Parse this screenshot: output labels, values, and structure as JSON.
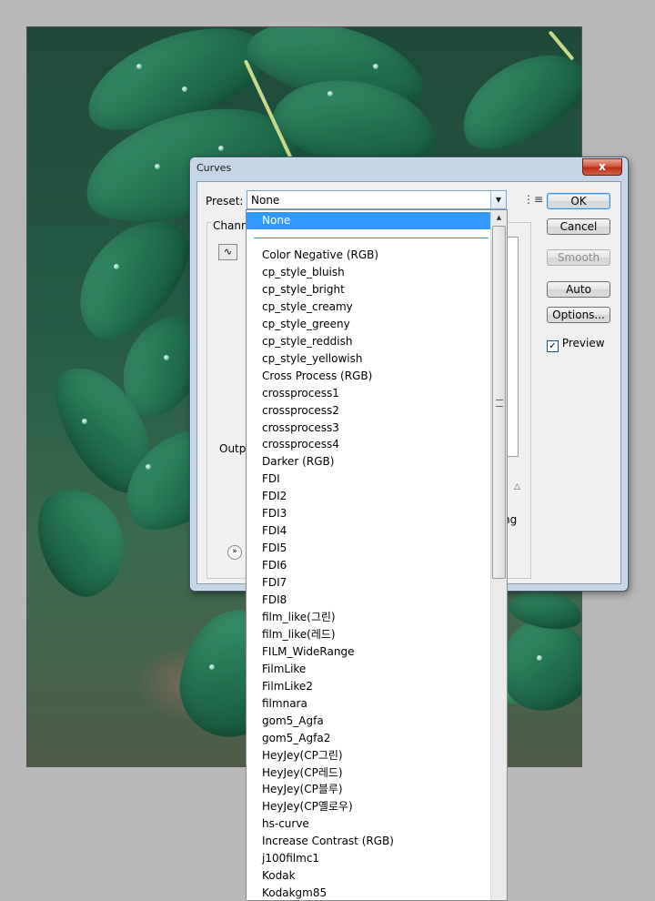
{
  "dialog": {
    "title": "Curves",
    "close_label": "x",
    "preset_label": "Preset:",
    "preset_value": "None",
    "channel_label": "Chann",
    "output_label": "Outp",
    "curve_tool_icon": "curve-icon",
    "fragment_right": "ng",
    "buttons": {
      "ok": "OK",
      "cancel": "Cancel",
      "smooth": "Smooth",
      "auto": "Auto",
      "options": "Options..."
    },
    "preview_label": "Preview",
    "preview_checked": true
  },
  "dropdown": {
    "selected": "None",
    "items": [
      "Color Negative (RGB)",
      "cp_style_bluish",
      "cp_style_bright",
      "cp_style_creamy",
      "cp_style_greeny",
      "cp_style_reddish",
      "cp_style_yellowish",
      "Cross Process (RGB)",
      "crossprocess1",
      "crossprocess2",
      "crossprocess3",
      "crossprocess4",
      "Darker (RGB)",
      "FDI",
      "FDI2",
      "FDI3",
      "FDI4",
      "FDI5",
      "FDI6",
      "FDI7",
      "FDI8",
      "film_like(그린)",
      "film_like(레드)",
      "FILM_WideRange",
      "FilmLike",
      "FilmLike2",
      "filmnara",
      "gom5_Agfa",
      "gom5_Agfa2",
      "HeyJey(CP그린)",
      "HeyJey(CP레드)",
      "HeyJey(CP블루)",
      "HeyJey(CP옐로우)",
      "hs-curve",
      "Increase Contrast (RGB)",
      "j100filmc1",
      "Kodak",
      "Kodakgm85"
    ]
  }
}
